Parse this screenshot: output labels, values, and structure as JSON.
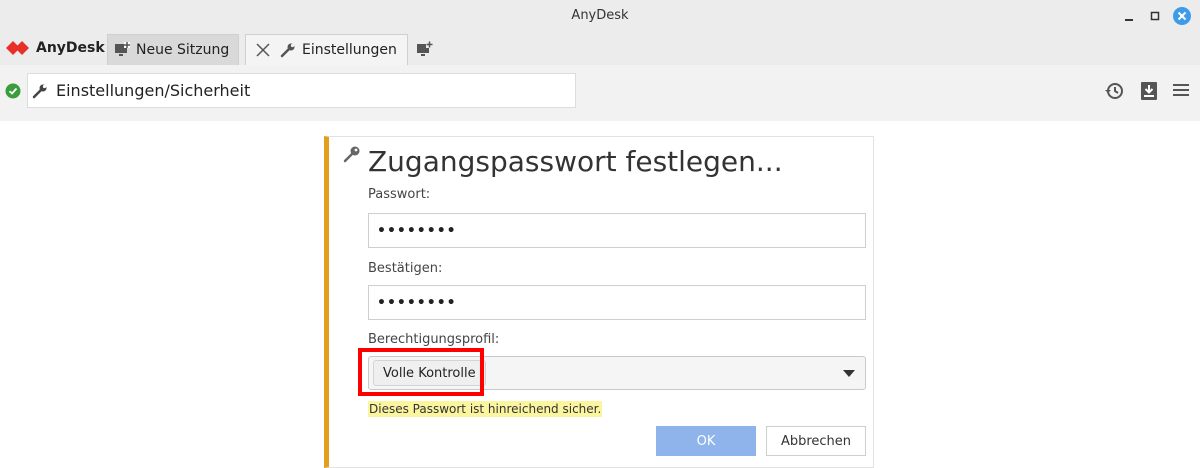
{
  "window": {
    "title": "AnyDesk"
  },
  "brand": {
    "name": "AnyDesk",
    "color": "#e8302b"
  },
  "tabs": [
    {
      "label": "Neue Sitzung",
      "icon": "monitor-icon"
    },
    {
      "label": "Einstellungen",
      "icon": "wrench-icon",
      "active": true
    }
  ],
  "address": {
    "value": "Einstellungen/Sicherheit",
    "status_color": "#3a9c3a"
  },
  "toolbar_icons": [
    "history-icon",
    "download-icon",
    "menu-icon"
  ],
  "dialog": {
    "title": "Zugangspasswort festlegen...",
    "password_label": "Passwort:",
    "password_value": "••••••••",
    "confirm_label": "Bestätigen:",
    "confirm_value": "••••••••",
    "profile_label": "Berechtigungsprofil:",
    "profile_value": "Volle Kontrolle",
    "strength_note": "Dieses Passwort ist hinreichend sicher.",
    "ok_label": "OK",
    "cancel_label": "Abbrechen",
    "accent_color": "#e39f1c"
  }
}
